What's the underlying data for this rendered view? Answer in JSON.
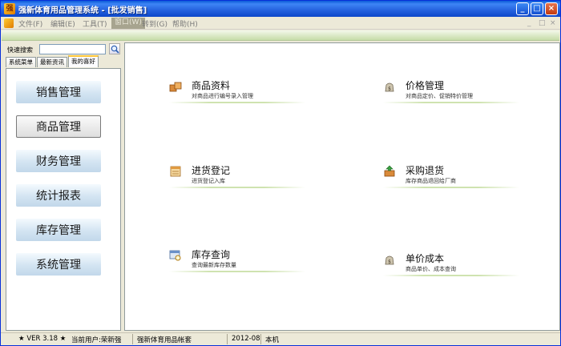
{
  "window": {
    "title": "强新体育用品管理系统 - [批发销售]",
    "controls": [
      "_",
      "□",
      "×"
    ]
  },
  "menu": {
    "items": [
      "文件(F)",
      "编辑(E)",
      "工具(T)",
      "窗口(W)",
      "转到(G)",
      "帮助(H)"
    ],
    "active_index": 3,
    "mdi_controls": [
      "_",
      "□",
      "×"
    ]
  },
  "sidebar": {
    "search_label": "快速搜索",
    "search_value": "",
    "tabs": [
      "系统菜单",
      "最新资讯",
      "我的喜好"
    ],
    "active_tab": 2,
    "nav": [
      "销售管理",
      "商品管理",
      "财务管理",
      "统计报表",
      "库存管理",
      "系统管理"
    ],
    "selected_nav": 1
  },
  "main": {
    "items": [
      {
        "name": "商品资料",
        "desc": "对商品进行编号录入管理",
        "icon": "boxes-icon"
      },
      {
        "name": "价格管理",
        "desc": "对商品定价、促销特价管理",
        "icon": "price-bag-icon"
      },
      {
        "name": "进货登记",
        "desc": "进货登记入库",
        "icon": "register-icon"
      },
      {
        "name": "采购退货",
        "desc": "库存商品退回给厂商",
        "icon": "return-goods-icon"
      },
      {
        "name": "库存查询",
        "desc": "查询最新库存数量",
        "icon": "inventory-query-icon"
      },
      {
        "name": "单价成本",
        "desc": "商品单价、成本查询",
        "icon": "cost-bag-icon"
      }
    ]
  },
  "status": {
    "version": "★ VER 3.18 ★",
    "user": "当前用户:荣新强",
    "account": "强新体育用品帐套",
    "period": "2012-08",
    "host": "本机"
  },
  "colors": {
    "titlebar": "#2461de",
    "accent_line": "#cfe3b0",
    "nav_button": "#d3e4f2"
  }
}
